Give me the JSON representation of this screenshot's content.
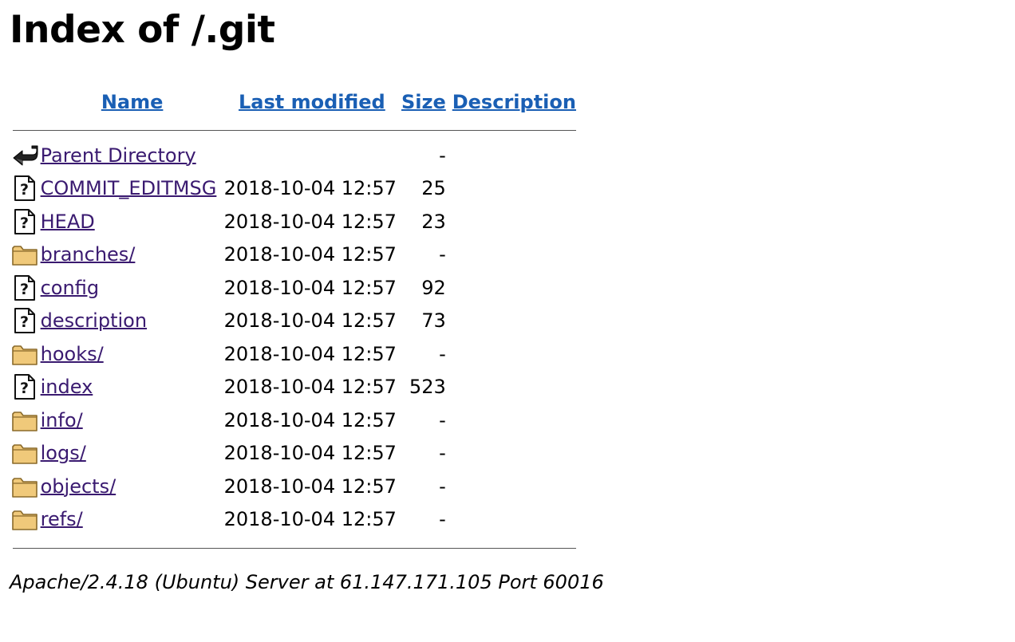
{
  "title": "Index of /.git",
  "columns": {
    "name": "Name",
    "last_modified": "Last modified",
    "size": "Size",
    "description": "Description"
  },
  "entries": [
    {
      "icon": "back-icon",
      "name": "Parent Directory",
      "modified": "",
      "size": "-",
      "description": ""
    },
    {
      "icon": "unknown-file-icon",
      "name": "COMMIT_EDITMSG",
      "modified": "2018-10-04 12:57",
      "size": "25",
      "description": ""
    },
    {
      "icon": "unknown-file-icon",
      "name": "HEAD",
      "modified": "2018-10-04 12:57",
      "size": "23",
      "description": ""
    },
    {
      "icon": "folder-icon",
      "name": "branches/",
      "modified": "2018-10-04 12:57",
      "size": "-",
      "description": ""
    },
    {
      "icon": "unknown-file-icon",
      "name": "config",
      "modified": "2018-10-04 12:57",
      "size": "92",
      "description": ""
    },
    {
      "icon": "unknown-file-icon",
      "name": "description",
      "modified": "2018-10-04 12:57",
      "size": "73",
      "description": ""
    },
    {
      "icon": "folder-icon",
      "name": "hooks/",
      "modified": "2018-10-04 12:57",
      "size": "-",
      "description": ""
    },
    {
      "icon": "unknown-file-icon",
      "name": "index",
      "modified": "2018-10-04 12:57",
      "size": "523",
      "description": ""
    },
    {
      "icon": "folder-icon",
      "name": "info/",
      "modified": "2018-10-04 12:57",
      "size": "-",
      "description": ""
    },
    {
      "icon": "folder-icon",
      "name": "logs/",
      "modified": "2018-10-04 12:57",
      "size": "-",
      "description": ""
    },
    {
      "icon": "folder-icon",
      "name": "objects/",
      "modified": "2018-10-04 12:57",
      "size": "-",
      "description": ""
    },
    {
      "icon": "folder-icon",
      "name": "refs/",
      "modified": "2018-10-04 12:57",
      "size": "-",
      "description": ""
    }
  ],
  "footer": "Apache/2.4.18 (Ubuntu) Server at 61.147.171.105 Port 60016",
  "colors": {
    "header_link": "#1a5fb4",
    "entry_link": "#3a1a70",
    "folder_fill": "#f0c97a",
    "folder_stroke": "#8a6a2a"
  }
}
